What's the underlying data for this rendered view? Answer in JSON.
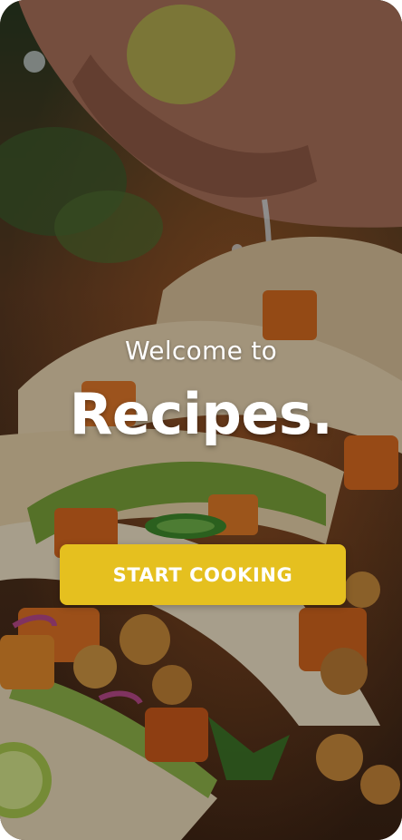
{
  "welcome": {
    "subtitle": "Welcome to",
    "title": "Recipes.",
    "cta_label": "START COOKING"
  },
  "background": {
    "description_icon": "food-photo-image"
  },
  "colors": {
    "cta": "#e5c01f",
    "text": "#ffffff"
  }
}
